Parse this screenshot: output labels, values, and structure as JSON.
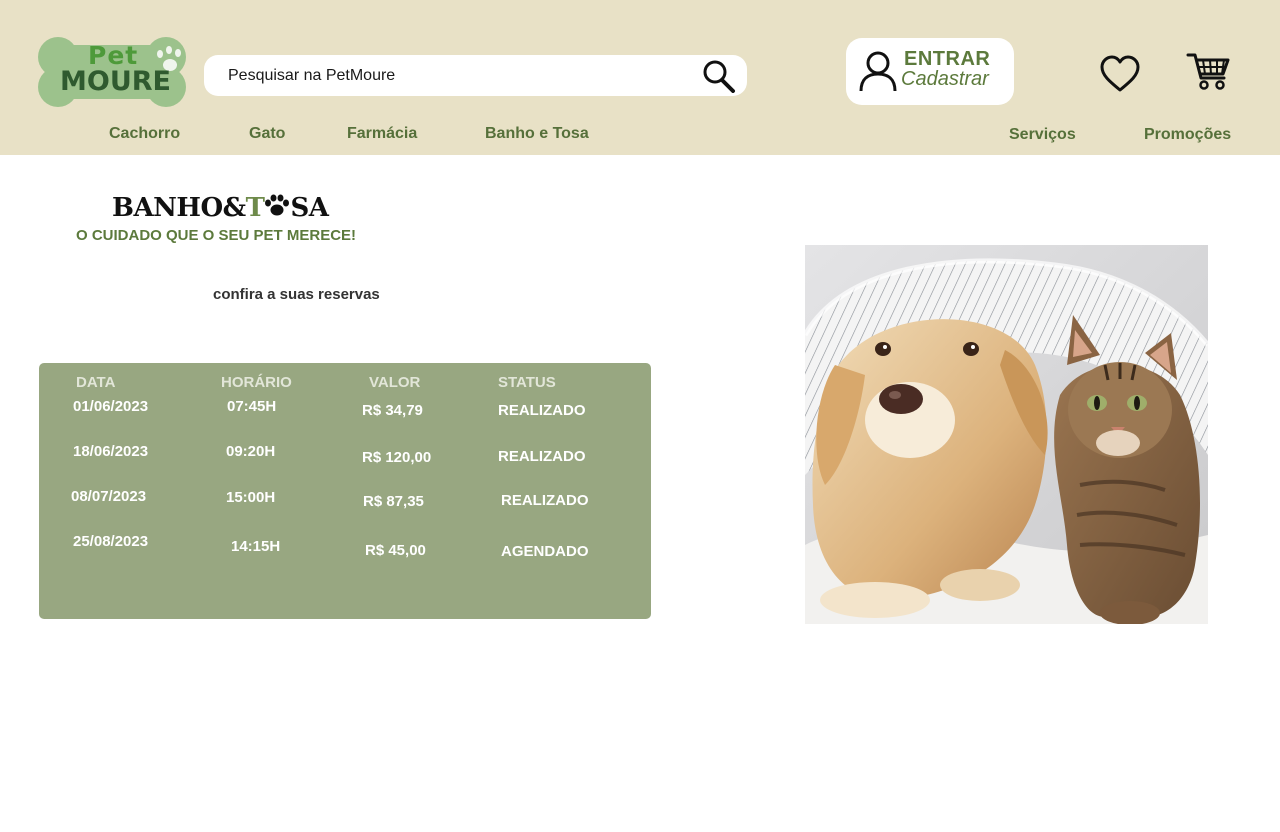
{
  "header": {
    "logo": {
      "line1": "Pet",
      "line2": "MOURE"
    },
    "search": {
      "placeholder": "Pesquisar na PetMoure",
      "icon": "search-icon"
    },
    "login": {
      "primary": "ENTRAR",
      "secondary": "Cadastrar",
      "icon": "user-icon"
    },
    "favorites_icon": "heart-icon",
    "cart_icon": "cart-icon",
    "nav_left": [
      "Cachorro",
      "Gato",
      "Farmácia",
      "Banho e Tosa"
    ],
    "nav_right": [
      "Serviços",
      "Promoções"
    ]
  },
  "main": {
    "brand": {
      "part1": "BANHO&",
      "part2": "T",
      "part3": "SA"
    },
    "tagline": "O CUIDADO QUE O SEU PET MERECE!",
    "subtitle": "confira a suas reservas",
    "table": {
      "headers": [
        "DATA",
        "HORÁRIO",
        "VALOR",
        "STATUS"
      ],
      "rows": [
        [
          "01/06/2023",
          "07:45H",
          "R$ 34,79",
          "REALIZADO"
        ],
        [
          "18/06/2023",
          "09:20H",
          "R$ 120,00",
          "REALIZADO"
        ],
        [
          "08/07/2023",
          "15:00H",
          "R$ 87,35",
          "REALIZADO"
        ],
        [
          "25/08/2023",
          "14:15H",
          "R$ 45,00",
          "AGENDADO"
        ]
      ]
    }
  },
  "colors": {
    "header_bg": "#e8e1c6",
    "accent_green": "#5c7a3c",
    "table_bg": "#98a781"
  }
}
